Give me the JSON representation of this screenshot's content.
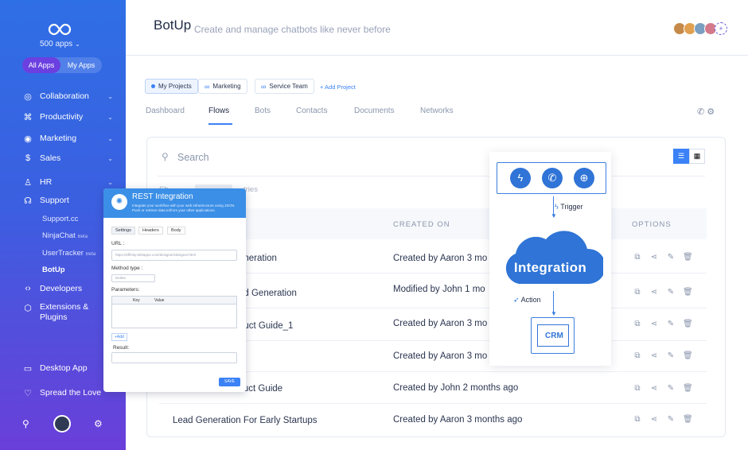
{
  "brand": {
    "app_name": "500 apps",
    "caret": "⌄"
  },
  "toggle": {
    "all": "All Apps",
    "mine": "My Apps"
  },
  "sidebar": {
    "items": [
      {
        "label": "Collaboration",
        "icon": "globe-icon"
      },
      {
        "label": "Productivity",
        "icon": "command-icon"
      },
      {
        "label": "Marketing",
        "icon": "target-icon"
      },
      {
        "label": "Sales",
        "icon": "dollar-icon"
      },
      {
        "label": "HR",
        "icon": "users-icon"
      },
      {
        "label": "Support",
        "icon": "headset-icon"
      },
      {
        "label": "Developers",
        "icon": "code-icon"
      },
      {
        "label": "Extensions & Plugins",
        "icon": "puzzle-icon"
      },
      {
        "label": "Desktop App",
        "icon": "monitor-icon"
      },
      {
        "label": "Spread the Love",
        "icon": "heart-icon"
      }
    ],
    "support_sub": [
      {
        "label": "Support.cc",
        "beta": ""
      },
      {
        "label": "NinjaChat",
        "beta": "Beta"
      },
      {
        "label": "UserTracker",
        "beta": "Beta"
      },
      {
        "label": "BotUp",
        "beta": ""
      }
    ]
  },
  "header": {
    "title": "BotUp",
    "subtitle": "Create and manage chatbots like never before"
  },
  "projects": {
    "chips": [
      "My Projects",
      "Marketing",
      "Service Team"
    ],
    "add": "+ Add Project"
  },
  "tabs": [
    "Dashboard",
    "Flows",
    "Bots",
    "Contacts",
    "Documents",
    "Networks"
  ],
  "search": {
    "placeholder": "Search"
  },
  "filter": {
    "left": "Sh",
    "right": "tries"
  },
  "table": {
    "headers": {
      "created": "CREATED ON",
      "options": "OPTIONS"
    },
    "rows": [
      {
        "name": "eneration",
        "created": "Created by Aaron 3 mo"
      },
      {
        "name": "ad Generation",
        "created": "Modified by John 1 mo"
      },
      {
        "name": "duct Guide_1",
        "created": "Created by Aaron  3 mo"
      },
      {
        "name": "",
        "created": "Created by Aaron 3 mo"
      },
      {
        "name": "Ecommerce Product Guide",
        "created": "Created by John 2 months ago"
      },
      {
        "name": "Lead Generation For Early Startups",
        "created": "Created by Aaron 3 months ago"
      }
    ]
  },
  "rest": {
    "title": "REST Integration",
    "desc": "Integrate your workflow with your web infrastructure using JSON. Push or retrieve data to/from your other applications.",
    "tabs": [
      "Settings",
      "Headers",
      "Body"
    ],
    "url_label": "URL :",
    "url_value": "https://effinity.500apps.com/designer/designer.html",
    "method_label": "Method type :",
    "method_value": "Delete",
    "params_label": "Parameters:",
    "key": "Key",
    "value": "Value",
    "add": "+Add",
    "result_label": "Result:",
    "save": "SAVE"
  },
  "integration": {
    "trigger": "Trigger",
    "title": "Integration",
    "action": "Action",
    "crm": "CRM"
  },
  "colors": {
    "accent": "#3b82f6",
    "sidebar_top": "#2f6fe6",
    "sidebar_bottom": "#6a3fd9"
  }
}
